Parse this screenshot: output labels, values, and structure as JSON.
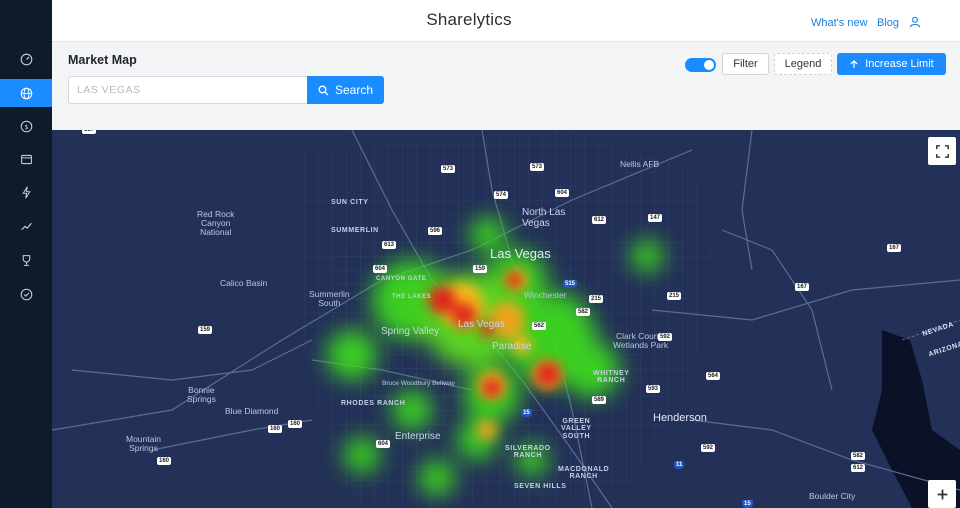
{
  "app": {
    "brand": "Sharelytics",
    "links": {
      "whats_new": "What's new",
      "blog": "Blog"
    }
  },
  "sidebar": {
    "items": [
      {
        "icon": "dashboard-icon",
        "active": false
      },
      {
        "icon": "globe-icon",
        "active": true
      },
      {
        "icon": "dollar-icon",
        "active": false
      },
      {
        "icon": "calendar-icon",
        "active": false
      },
      {
        "icon": "lightning-icon",
        "active": false
      },
      {
        "icon": "trend-icon",
        "active": false
      },
      {
        "icon": "trophy-icon",
        "active": false
      },
      {
        "icon": "check-circle-icon",
        "active": false
      }
    ]
  },
  "panel": {
    "title": "Market Map",
    "search": {
      "placeholder": "LAS VEGAS",
      "value": "",
      "button_label": "Search"
    },
    "toggle_on": true,
    "filter_label": "Filter",
    "legend_label": "Legend",
    "increase_label": "Increase Limit"
  },
  "map": {
    "places": {
      "las_vegas": "Las Vegas",
      "north_las_vegas": "North Las\nVegas",
      "nellis_afb": "Nellis AFB",
      "sun_city": "SUN CITY",
      "summerlin": "SUMMERLIN",
      "red_rock": "Red Rock\nCanyon\nNational",
      "calico_basin": "Calico Basin",
      "summerlin_south": "Summerlin\nSouth",
      "spring_valley": "Spring Valley",
      "las_vegas_strip": "Las Vegas",
      "paradise": "Paradise",
      "winchester": "Winchester",
      "clark_county": "Clark County\nWetlands Park",
      "whitney_ranch": "WHITNEY\nRANCH",
      "bonnie_springs": "Bonnie\nSprings",
      "blue_diamond": "Blue Diamond",
      "rhodes_ranch": "RHODES RANCH",
      "enterprise": "Enterprise",
      "green_valley_south": "GREEN\nVALLEY\nSOUTH",
      "henderson": "Henderson",
      "silverado_ranch": "SILVERADO\nRANCH",
      "macdonald_ranch": "MACDONALD\nRANCH",
      "seven_hills": "SEVEN HILLS",
      "mountain_springs": "Mountain\nSprings",
      "boulder_city": "Boulder City",
      "nevada": "NEVADA",
      "arizona": "ARIZONA",
      "bruce_woodbury": "Bruce Woodbury Beltway",
      "the_lakes": "THE LAKES",
      "canyon_gate": "CANYON GATE"
    },
    "shields": [
      "157",
      "573",
      "573",
      "574",
      "604",
      "612",
      "147",
      "596",
      "613",
      "159",
      "159",
      "160",
      "160",
      "160",
      "582",
      "562",
      "564",
      "167",
      "167",
      "589",
      "593",
      "592",
      "592",
      "582",
      "215",
      "215",
      "604",
      "604",
      "612"
    ],
    "interstate_shields": [
      "515",
      "15",
      "11",
      "15"
    ]
  },
  "colors": {
    "accent": "#1a8cff",
    "sidebar_bg": "#0d1b2a",
    "map_bg": "#233158"
  }
}
